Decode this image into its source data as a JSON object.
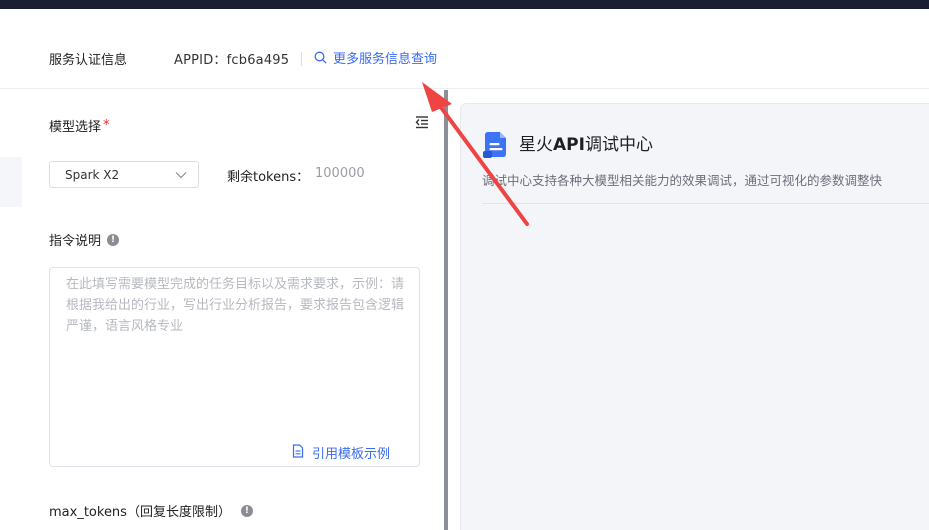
{
  "service": {
    "title": "服务认证信息",
    "appid": "APPID：fcb6a495",
    "more_link": "更多服务信息查询"
  },
  "model": {
    "label": "模型选择",
    "required_mark": "*",
    "selected": "Spark X2",
    "tokens_label": "剩余tokens：",
    "tokens_value": "100000"
  },
  "instruction": {
    "label": "指令说明",
    "placeholder": "在此填写需要模型完成的任务目标以及需求要求，示例：请根据我给出的行业，写出行业分析报告，要求报告包含逻辑严谨，语言风格专业",
    "template_link": "引用模板示例"
  },
  "max_tokens": {
    "label": "max_tokens（回复长度限制）"
  },
  "debug_center": {
    "title_pre": "星火",
    "title_api": "API",
    "title_post": "调试中心",
    "description": "调试中心支持各种大模型相关能力的效果调试，通过可视化的参数调整快"
  },
  "colors": {
    "link": "#3a6bf5",
    "required": "#f5222d",
    "annotation_arrow": "#ee4444",
    "logo": "#3d73f5"
  },
  "icons": {
    "search": "search-icon",
    "collapse": "collapse-panel-icon",
    "info": "info-icon",
    "chevron": "chevron-down-icon",
    "document": "document-icon",
    "logo": "spark-logo-icon",
    "arrow": "annotation-arrow"
  }
}
